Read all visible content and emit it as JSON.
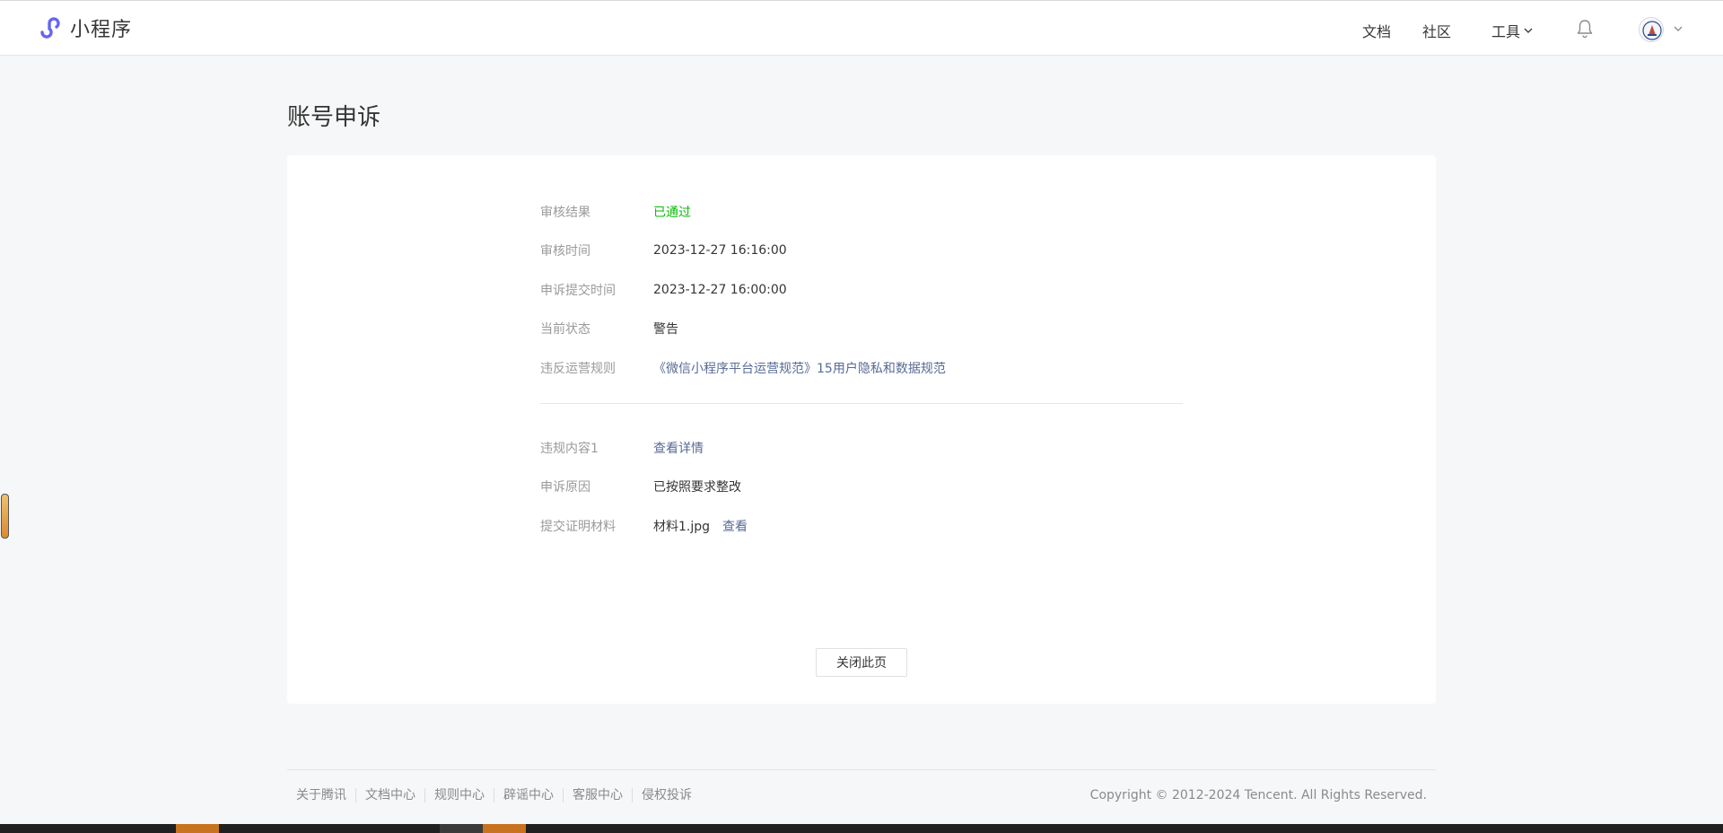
{
  "header": {
    "brand_name": "小程序",
    "nav": {
      "docs": "文档",
      "community": "社区",
      "tools": "工具"
    }
  },
  "page": {
    "title": "账号申诉"
  },
  "details": {
    "result_label": "审核结果",
    "result_value": "已通过",
    "review_time_label": "审核时间",
    "review_time_value": "2023-12-27 16:16:00",
    "submit_time_label": "申诉提交时间",
    "submit_time_value": "2023-12-27 16:00:00",
    "status_label": "当前状态",
    "status_value": "警告",
    "rule_label": "违反运营规则",
    "rule_value": "《微信小程序平台运营规范》15用户隐私和数据规范",
    "violation_label": "违规内容1",
    "violation_link": "查看详情",
    "reason_label": "申诉原因",
    "reason_value": "已按照要求整改",
    "material_label": "提交证明材料",
    "material_file": "材料1.jpg",
    "material_view": "查看"
  },
  "actions": {
    "close_label": "关闭此页"
  },
  "footer": {
    "links": [
      "关于腾讯",
      "文档中心",
      "规则中心",
      "辟谣中心",
      "客服中心",
      "侵权投诉"
    ],
    "copyright": "Copyright © 2012-2024 Tencent. All Rights Reserved."
  },
  "colors": {
    "success": "#09bb07",
    "link": "#576b95",
    "brand": "#6467f0"
  }
}
